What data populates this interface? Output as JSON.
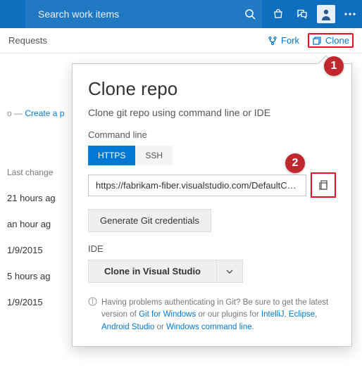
{
  "top": {
    "search_placeholder": "Search work items"
  },
  "subbar": {
    "title": "Requests",
    "fork": "Fork",
    "clone": "Clone"
  },
  "breadcrumb": {
    "sep": "o —",
    "create": "Create a p"
  },
  "list": {
    "header": "Last change",
    "rows": [
      "21 hours ag",
      "an hour ag",
      "1/9/2015",
      "5 hours ag",
      "1/9/2015"
    ]
  },
  "callout": {
    "title": "Clone repo",
    "subtitle": "Clone git repo using command line or IDE",
    "cmd_label": "Command line",
    "tabs": {
      "https": "HTTPS",
      "ssh": "SSH"
    },
    "url": "https://fabrikam-fiber.visualstudio.com/DefaultColl...",
    "gen_creds": "Generate Git credentials",
    "ide_label": "IDE",
    "ide_button": "Clone in Visual Studio",
    "help_pre": "Having problems authenticating in Git? Be sure to get the latest version of ",
    "help_git": "Git for Windows",
    "help_mid": " or our plugins for ",
    "help_intellij": "IntelliJ",
    "help_sep1": ", ",
    "help_eclipse": "Eclipse",
    "help_sep2": ", ",
    "help_as": "Android Studio",
    "help_or": " or ",
    "help_cmd": "Windows command line",
    "help_end": "."
  },
  "badges": {
    "one": "1",
    "two": "2"
  }
}
